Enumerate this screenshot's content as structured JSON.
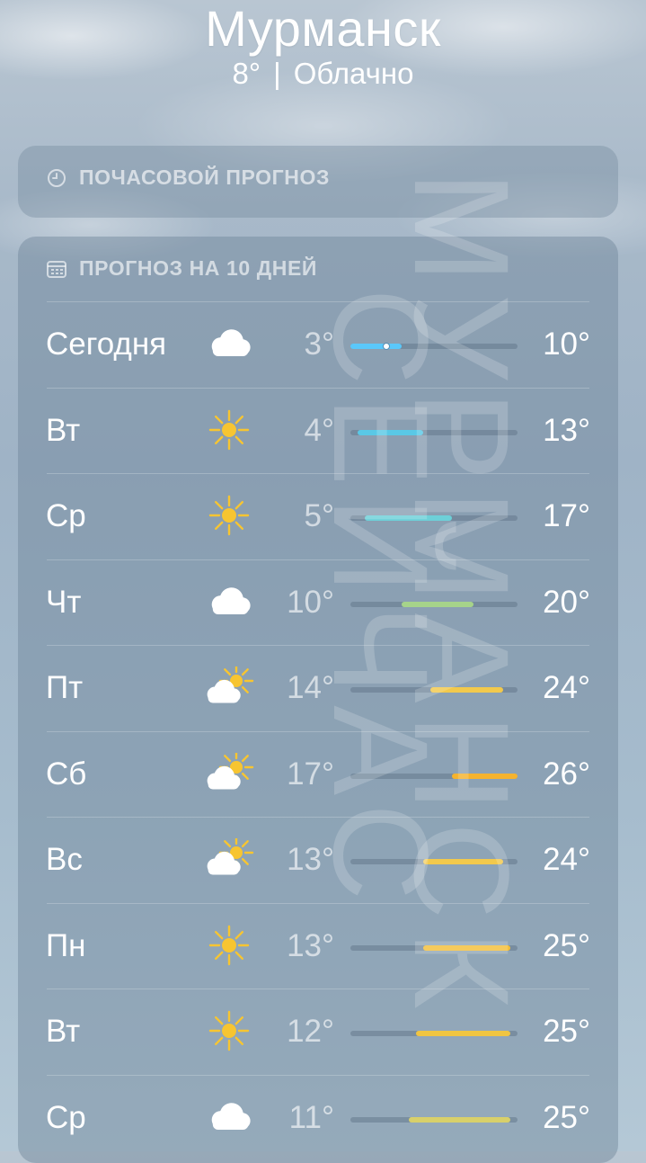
{
  "location": {
    "city": "Мурманск",
    "temp": "8°",
    "separator": "|",
    "condition": "Облачно"
  },
  "hourly": {
    "title": "ПОЧАСОВОЙ ПРОГНОЗ",
    "icon": "clock-icon"
  },
  "ten_day": {
    "title": "ПРОГНОЗ НА 10 ДНЕЙ",
    "icon": "calendar-icon",
    "range": {
      "min": 3,
      "max": 26
    },
    "days": [
      {
        "day": "Сегодня",
        "icon": "cloud",
        "low": "3°",
        "high": "10°",
        "low_v": 3,
        "high_v": 10,
        "current": 8,
        "color": "#5ac8fa"
      },
      {
        "day": "Вт",
        "icon": "sun",
        "low": "4°",
        "high": "13°",
        "low_v": 4,
        "high_v": 13,
        "color": "#5ac8e6"
      },
      {
        "day": "Ср",
        "icon": "sun",
        "low": "5°",
        "high": "17°",
        "low_v": 5,
        "high_v": 17,
        "color": "#6dd0d8"
      },
      {
        "day": "Чт",
        "icon": "cloud",
        "low": "10°",
        "high": "20°",
        "low_v": 10,
        "high_v": 20,
        "color": "#a6d38a"
      },
      {
        "day": "Пт",
        "icon": "sun-cloud",
        "low": "14°",
        "high": "24°",
        "low_v": 14,
        "high_v": 24,
        "color": "#f2c94c"
      },
      {
        "day": "Сб",
        "icon": "sun-cloud",
        "low": "17°",
        "high": "26°",
        "low_v": 17,
        "high_v": 26,
        "color": "#f5b32e"
      },
      {
        "day": "Вс",
        "icon": "sun-cloud",
        "low": "13°",
        "high": "24°",
        "low_v": 13,
        "high_v": 24,
        "color": "#f2c94c"
      },
      {
        "day": "Пн",
        "icon": "sun",
        "low": "13°",
        "high": "25°",
        "low_v": 13,
        "high_v": 25,
        "color": "#f3bf3a"
      },
      {
        "day": "Вт",
        "icon": "sun",
        "low": "12°",
        "high": "25°",
        "low_v": 12,
        "high_v": 25,
        "color": "#f0c542"
      },
      {
        "day": "Ср",
        "icon": "cloud",
        "low": "11°",
        "high": "25°",
        "low_v": 11,
        "high_v": 25,
        "color": "#d8d06a"
      }
    ]
  },
  "watermark": {
    "line1": "МУРМАНСК",
    "line2": "СЕЙЧАС"
  }
}
